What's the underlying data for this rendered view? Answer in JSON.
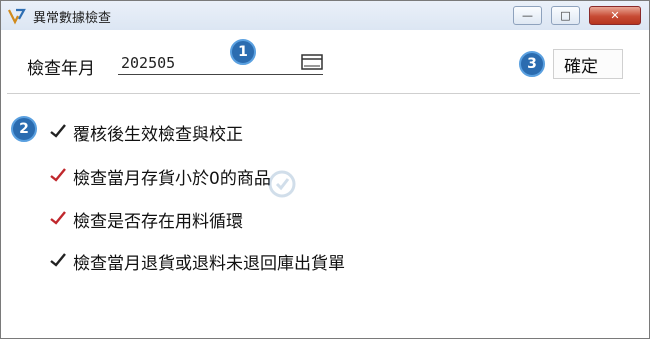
{
  "window": {
    "title": "異常數據檢查",
    "buttons": {
      "minimize": "—",
      "maximize": "□",
      "close": "✕"
    }
  },
  "form": {
    "period_label": "檢查年月",
    "period_value": "202505",
    "ok_label": "確定"
  },
  "badges": [
    "1",
    "2",
    "3"
  ],
  "options": [
    {
      "label": "覆核後生效檢查與校正",
      "checked": true
    },
    {
      "label": "檢查當月存貨小於0的商品",
      "checked": true
    },
    {
      "label": "檢查是否存在用料循環",
      "checked": true
    },
    {
      "label": "檢查當月退貨或退料未退回庫出貨單",
      "checked": true
    }
  ],
  "colors": {
    "badge": "#2b6cb0",
    "checkmark_red": "#c0282d",
    "checkmark_dark": "#222222",
    "titlebar": "#dce6f3"
  },
  "icons": {
    "app": "app-logo-icon",
    "calendar": "calendar-icon",
    "check": "checkmark-icon"
  }
}
